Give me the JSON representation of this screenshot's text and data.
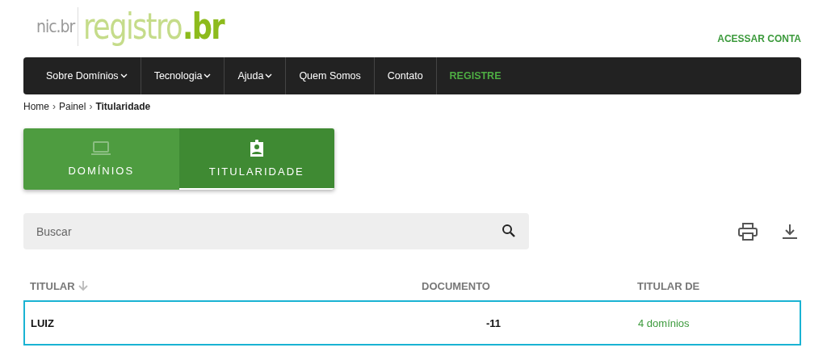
{
  "brand": {
    "parent": "nic.br",
    "name": "registro",
    "suffix": ".br"
  },
  "account_link": "ACESSAR CONTA",
  "nav": [
    {
      "label": "Sobre Domínios",
      "kind": "menu"
    },
    {
      "label": "Tecnologia",
      "kind": "menu"
    },
    {
      "label": "Ajuda",
      "kind": "menu"
    },
    {
      "label": "Quem Somos",
      "kind": "link"
    },
    {
      "label": "Contato",
      "kind": "link"
    },
    {
      "label": "REGISTRE",
      "kind": "cta"
    }
  ],
  "breadcrumb": {
    "separator": "›",
    "items": [
      "Home",
      "Painel",
      "Titularidade"
    ]
  },
  "tabs": [
    {
      "label": "DOMÍNIOS",
      "kind": "laptop",
      "selected": false
    },
    {
      "label": "TITULARIDADE",
      "kind": "badge",
      "selected": true
    }
  ],
  "search": {
    "placeholder": "Buscar"
  },
  "table": {
    "columns": [
      {
        "label": "TITULAR",
        "sorted": true
      },
      {
        "label": "DOCUMENTO",
        "sorted": false
      },
      {
        "label": "TITULAR DE",
        "sorted": false
      }
    ],
    "rows": [
      {
        "titular": "LUIZ",
        "documento": "-11",
        "titular_de": "4 domínios",
        "selected": true
      }
    ]
  }
}
